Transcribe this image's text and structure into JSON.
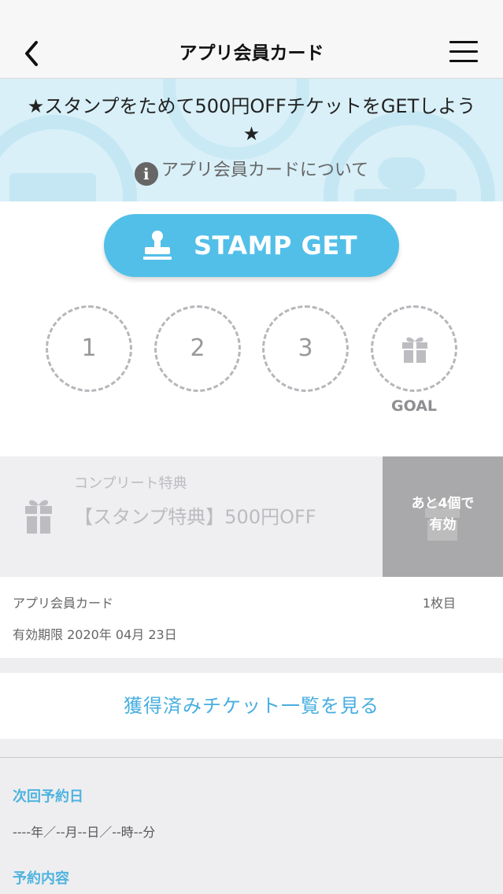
{
  "nav": {
    "title": "アプリ会員カード"
  },
  "banner": {
    "headline": "★スタンプをためて500円OFFチケットをGETしよう★",
    "info_link": "アプリ会員カードについて"
  },
  "stamp": {
    "button_label": "STAMP GET",
    "slots": [
      "1",
      "2",
      "3"
    ],
    "goal_label": "GOAL"
  },
  "reward": {
    "subtitle": "コンプリート特典",
    "title": "【スタンプ特典】500円OFF",
    "status": "あと4個で\n有効"
  },
  "card": {
    "name": "アプリ会員カード",
    "count": "1枚目",
    "expiry": "有効期限 2020年 04月 23日"
  },
  "ticket_link": "獲得済みチケット一覧を見る",
  "reservation": {
    "next_label": "次回予約日",
    "next_value": "----年／--月--日／--時--分",
    "content_label": "予約内容"
  },
  "colors": {
    "accent": "#52bfe8",
    "link": "#47aee0",
    "banner_bg": "#d9f0f8"
  }
}
